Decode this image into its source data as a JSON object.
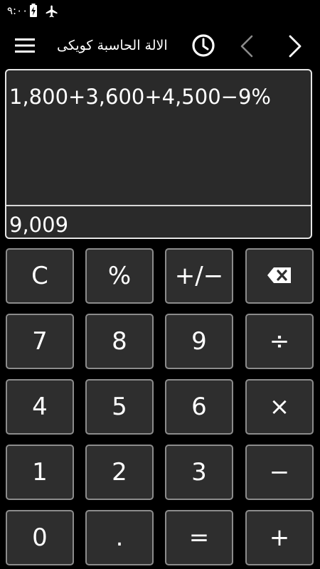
{
  "status_bar": {
    "time": "٩:٠٠",
    "icons": [
      "battery-charging-icon",
      "airplane-mode-icon"
    ]
  },
  "toolbar": {
    "icons": [
      "menu-icon",
      "history-clock-icon",
      "chevron-left-icon",
      "chevron-right-icon"
    ],
    "title": "الالة الحاسبة كويكى"
  },
  "display": {
    "expression": "1,800+3,600+4,500−9%",
    "result": "9,009"
  },
  "keypad": {
    "rows": [
      [
        {
          "label": "C",
          "name": "clear-key"
        },
        {
          "label": "%",
          "name": "percent-key"
        },
        {
          "label": "+/−",
          "name": "plus-minus-key"
        },
        {
          "label": "",
          "name": "backspace-key",
          "icon": "backspace-icon"
        }
      ],
      [
        {
          "label": "7",
          "name": "digit-7-key"
        },
        {
          "label": "8",
          "name": "digit-8-key"
        },
        {
          "label": "9",
          "name": "digit-9-key"
        },
        {
          "label": "÷",
          "name": "divide-key"
        }
      ],
      [
        {
          "label": "4",
          "name": "digit-4-key"
        },
        {
          "label": "5",
          "name": "digit-5-key"
        },
        {
          "label": "6",
          "name": "digit-6-key"
        },
        {
          "label": "×",
          "name": "multiply-key"
        }
      ],
      [
        {
          "label": "1",
          "name": "digit-1-key"
        },
        {
          "label": "2",
          "name": "digit-2-key"
        },
        {
          "label": "3",
          "name": "digit-3-key"
        },
        {
          "label": "−",
          "name": "minus-key"
        }
      ],
      [
        {
          "label": "0",
          "name": "digit-0-key"
        },
        {
          "label": ".",
          "name": "decimal-point-key"
        },
        {
          "label": "=",
          "name": "equals-key"
        },
        {
          "label": "+",
          "name": "plus-key"
        }
      ]
    ]
  },
  "colors": {
    "background": "#000000",
    "panel": "#2a2a2a",
    "key_background": "#2e2e2e",
    "key_border": "#8c8c8c",
    "text": "#ffffff"
  }
}
